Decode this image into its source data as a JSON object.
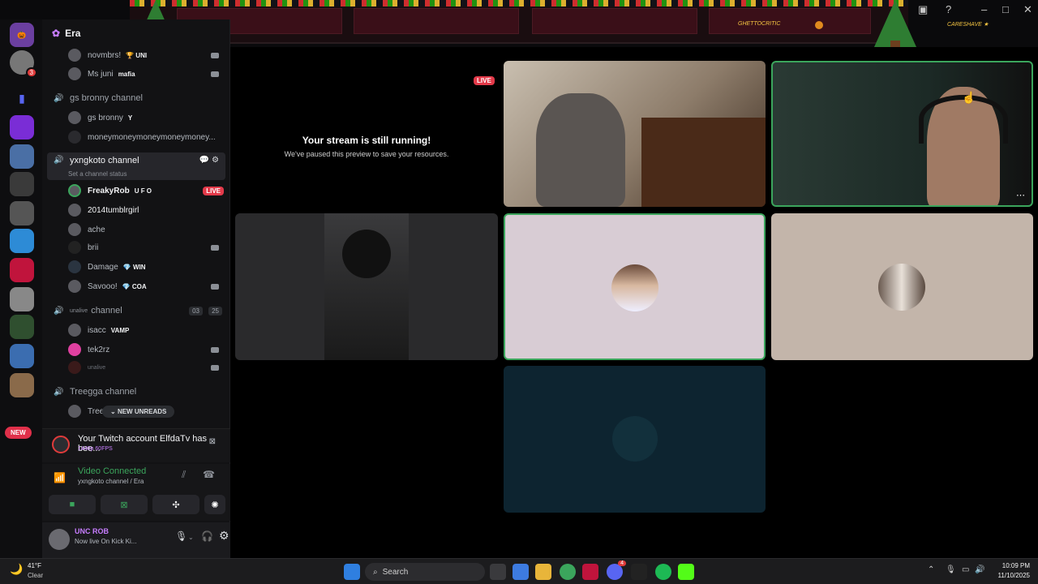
{
  "window": {
    "top_left_label": "",
    "top_small_1": "GHETTOCRITIC",
    "top_small_2": "CARESHAVE ★"
  },
  "rail": {
    "dm_badge": "3",
    "new_label": "NEW"
  },
  "sidebar": {
    "server_name": "Era",
    "rows": [
      {
        "name": "novmbrs!",
        "tag": "🏆 UNI"
      },
      {
        "name": "Ms juni",
        "tag": "mafia"
      },
      {
        "channel": "gs bronny channel"
      },
      {
        "name": "gs bronny",
        "tag": "Y"
      },
      {
        "name": "moneymoneymoneymoneymoney..."
      },
      {
        "channel": "yxngkoto channel",
        "status": "Set a channel status"
      },
      {
        "name": "FreakyRob",
        "tag": "U F O",
        "live": "LIVE"
      },
      {
        "name": "2014tumblrgirl"
      },
      {
        "name": "ache"
      },
      {
        "name": "brii"
      },
      {
        "name": "Damage",
        "tag": "💎 WIN"
      },
      {
        "name": "Savooo!",
        "tag": "💎 COA"
      },
      {
        "channel": "channel",
        "prefix": "unalive",
        "cam_count": "03",
        "count": "25"
      },
      {
        "name": "isacc",
        "tag": "VAMP"
      },
      {
        "name": "tek2rz"
      },
      {
        "name": "unalive"
      },
      {
        "channel": "Treegga channel"
      },
      {
        "name": "Tree"
      }
    ],
    "new_unreads": "NEW UNREADS"
  },
  "notification": {
    "text": "Your Twitch account ElfdaTv has bee...",
    "sub": "1440p 60FPS"
  },
  "voice": {
    "status": "Video Connected",
    "location": "yxngkoto channel / Era"
  },
  "user": {
    "name": "UNC ROB",
    "status": "Now live On Kick Ki..."
  },
  "stage": {
    "live_tag": "LIVE",
    "paused_title": "Your stream is still running!",
    "paused_sub": "We've paused this preview to save your resources."
  },
  "taskbar": {
    "weather_temp": "41°F",
    "weather_desc": "Clear",
    "search": "Search",
    "time": "10:09 PM",
    "date": "11/10/2025",
    "badge": "4"
  },
  "colors": {
    "live": "#e33a4a",
    "connected": "#3ba55c",
    "accent_pink": "#e0304a"
  }
}
